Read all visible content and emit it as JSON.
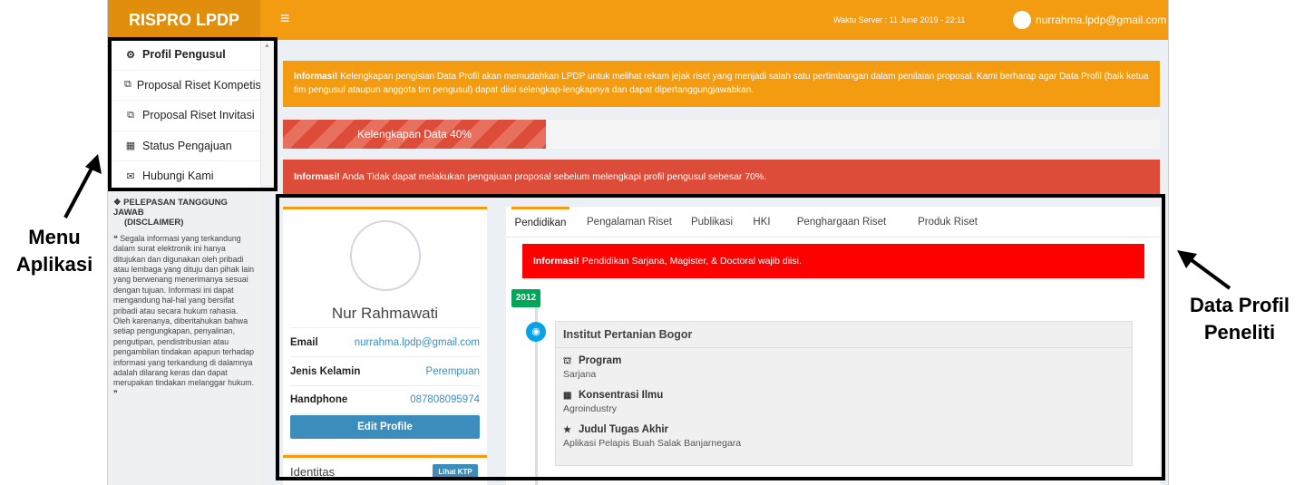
{
  "app": {
    "brand": "RISPRO LPDP",
    "menu_toggle_icon": "hamburger-icon",
    "server_time": "Waktu Server : 11 June 2019 - 22:11",
    "user_email": "nurrahma.lpdp@gmail.com"
  },
  "sidebar": {
    "items": [
      {
        "label": "Profil Pengusul",
        "icon": "dashboard-icon",
        "active": true
      },
      {
        "label": "Proposal Riset Kompetisi",
        "icon": "copy-icon"
      },
      {
        "label": "Proposal Riset Invitasi",
        "icon": "copy-icon"
      },
      {
        "label": "Status Pengajuan",
        "icon": "grid-icon"
      },
      {
        "label": "Hubungi Kami",
        "icon": "envelope-icon"
      }
    ],
    "disclaimer_title": "PELEPASAN TANGGUNG JAWAB",
    "disclaimer_sub": "(DISCLAIMER)",
    "disclaimer_body": "Segala informasi yang terkandung dalam surat elektronik ini hanya ditujukan dan digunakan oleh pribadi atau lembaga yang dituju dan pihak lain yang berwenang menerimanya sesuai dengan tujuan. Informasi ini dapat mengandung hal-hal yang bersifat pribadi atau secara hukum rahasia. Oleh karenanya, diberitahukan bahwa setiap pengungkapan, penyalinan, pengutipan, pendistribusian atau pengambilan tindakan apapun terhadap informasi yang terkandung di dalamnya adalah dilarang keras dan dapat merupakan tindakan melanggar hukum."
  },
  "alerts": {
    "info_label": "Informasi!",
    "info_profile": "Kelengkapan pengisian Data Profil akan memudahkan LPDP untuk melihat rekam jejak riset yang menjadi salah satu pertimbangan dalam penilaian proposal. Kami berharap agar Data Profil (baik ketua tim pengusul ataupun anggota tim pengusul) dapat diisi selengkap-lengkapnya dan dapat dipertanggungjawabkan.",
    "warning": "Anda Tidak dapat melakukan pengajuan proposal sebelum melengkapi profil pengusul sebesar 70%.",
    "education": "Pendidikan Sarjana, Magister, & Doctoral wajib diisi."
  },
  "progress": {
    "label": "Kelengkapan Data 40%",
    "value": 0.3
  },
  "profile": {
    "name": "Nur Rahmawati",
    "fields": [
      {
        "key": "Email",
        "value": "nurrahma.lpdp@gmail.com"
      },
      {
        "key": "Jenis Kelamin",
        "value": "Perempuan"
      },
      {
        "key": "Handphone",
        "value": "087808095974"
      }
    ],
    "edit_button": "Edit Profile",
    "identity_title": "Identitas",
    "ktp_button": "Lihat KTP"
  },
  "tabs": [
    "Pendidikan",
    "Pengalaman Riset",
    "Publikasi",
    "HKI",
    "Penghargaan Riset",
    "Produk Riset"
  ],
  "timeline": {
    "year": "2012",
    "institution": "Institut Pertanian Bogor",
    "program_label": "Program",
    "program": "Sarjana",
    "concentration_label": "Konsentrasi Ilmu",
    "concentration": "Agroindustry",
    "thesis_label": "Judul Tugas Akhir",
    "thesis": "Aplikasi Pelapis Buah Salak Banjarnegara"
  },
  "annotations": {
    "menu_label": "Menu Aplikasi",
    "data_label": "Data Profil Peneliti"
  }
}
